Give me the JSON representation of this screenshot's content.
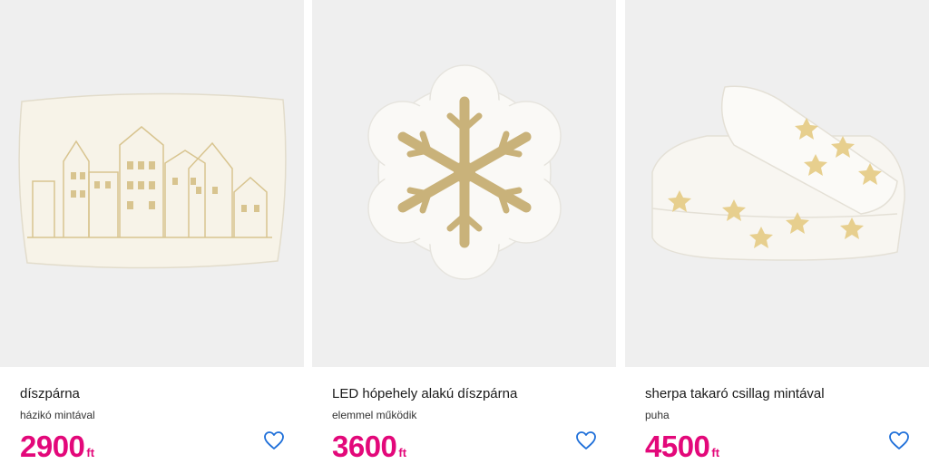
{
  "products": [
    {
      "title": "díszpárna",
      "subtitle": "házikó mintával",
      "price": "2900",
      "currency": "ft",
      "image": "house-pillow-image"
    },
    {
      "title": "LED hópehely alakú díszpárna",
      "subtitle": "elemmel működik",
      "price": "3600",
      "currency": "ft",
      "image": "snowflake-pillow-image"
    },
    {
      "title": "sherpa takaró csillag mintával",
      "subtitle": "puha",
      "price": "4500",
      "currency": "ft",
      "image": "star-blanket-image"
    }
  ],
  "icons": {
    "favorite": "heart-outline-icon"
  },
  "colors": {
    "price": "#e3087a",
    "favorite_icon": "#1e6fd9",
    "image_background": "#efefef"
  }
}
